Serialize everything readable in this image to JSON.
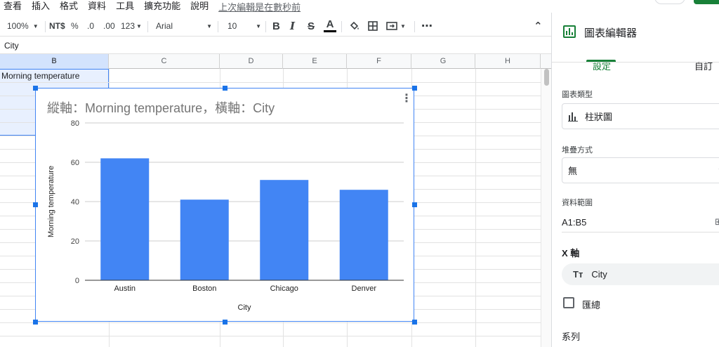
{
  "menu": {
    "items": [
      "查看",
      "插入",
      "格式",
      "資料",
      "工具",
      "擴充功能",
      "說明"
    ],
    "last_edit": "上次編輯是在數秒前"
  },
  "toolbar": {
    "zoom": "100%",
    "currency": "NT$",
    "percent": "%",
    "decrease_decimal": ".0",
    "increase_decimal": ".00",
    "number_format": "123",
    "font": "Arial",
    "font_size": "10",
    "bold": "B",
    "italic": "I",
    "strikethrough": "S",
    "text_color": "A",
    "more": "⋯",
    "collapse": "⌃"
  },
  "formula_bar": {
    "cell_value": "City"
  },
  "grid": {
    "columns": [
      "B",
      "C",
      "D",
      "E",
      "F",
      "G",
      "H"
    ],
    "cell_B1": "Morning temperature"
  },
  "chart": {
    "title": "縱軸：Morning temperature，橫軸：City",
    "menu_icon": "kebab-menu-icon",
    "bar_color": "#4285f4"
  },
  "chart_data": {
    "type": "bar",
    "title": "縱軸：Morning temperature，橫軸：City",
    "categories": [
      "Austin",
      "Boston",
      "Chicago",
      "Denver"
    ],
    "series": [
      {
        "name": "Morning temperature",
        "values": [
          62,
          41,
          51,
          46
        ]
      }
    ],
    "xlabel": "City",
    "ylabel": "Morning temperature",
    "ylim": [
      0,
      80
    ],
    "yticks": [
      0,
      20,
      40,
      60,
      80
    ],
    "grid": true,
    "legend": "none"
  },
  "panel": {
    "title": "圖表編輯器",
    "tab_setup": "設定",
    "tab_customize": "自訂",
    "chart_type_label": "圖表類型",
    "chart_type_value": "柱狀圖",
    "stacking_label": "堆疊方式",
    "stacking_value": "無",
    "data_range_label": "資料範圍",
    "data_range_value": "A1:B5",
    "x_axis_label": "X 軸",
    "x_axis_value": "City",
    "aggregate_label": "匯總",
    "series_label": "系列",
    "accent_color": "#188038"
  }
}
